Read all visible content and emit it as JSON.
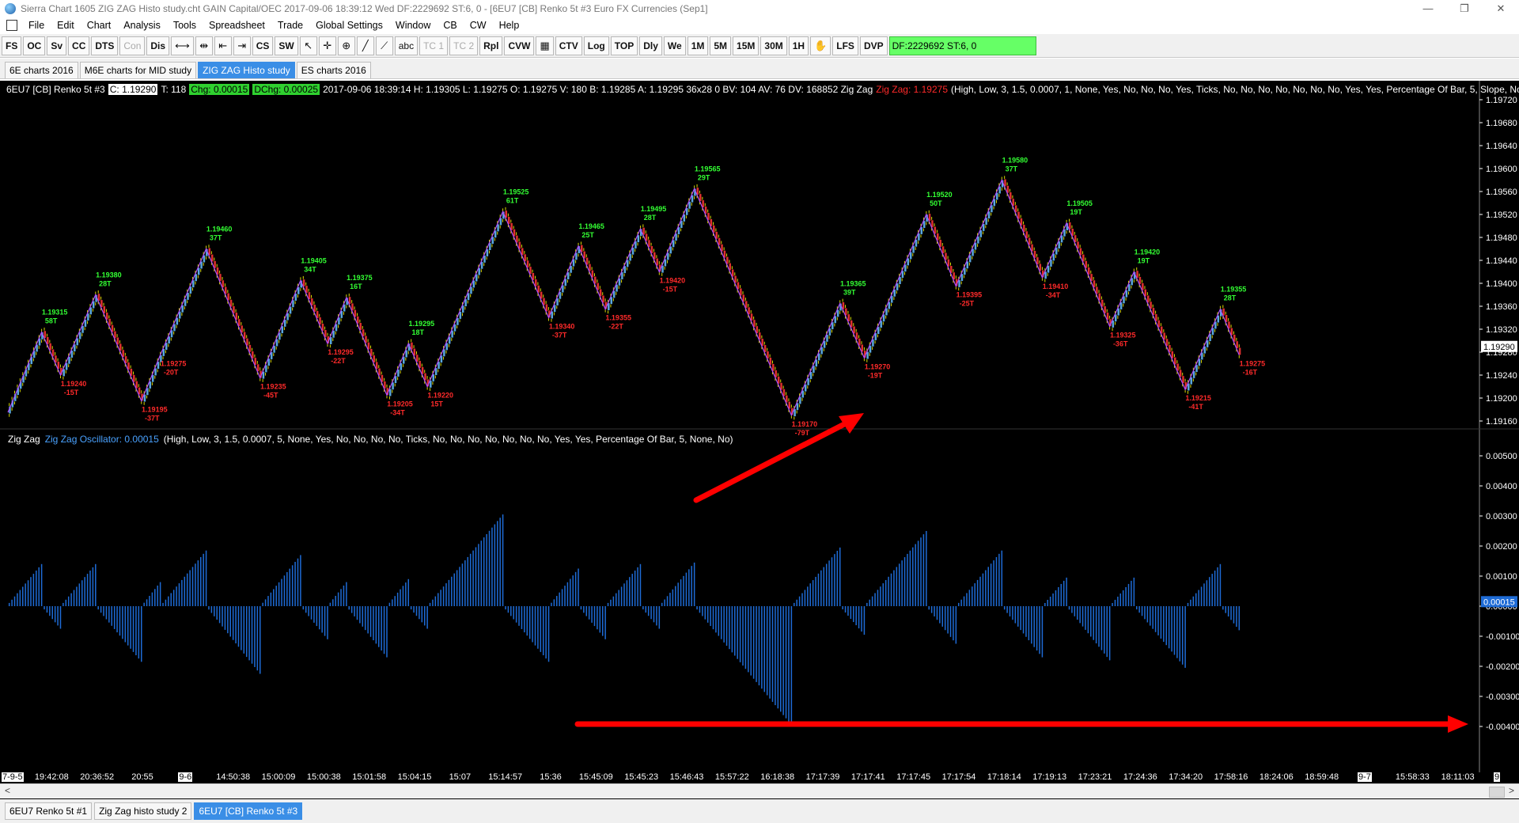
{
  "window": {
    "title": "Sierra Chart 1605 ZIG ZAG Histo study.cht  GAIN Capital/OEC 2017-09-06  18:39:12 Wed  DF:2229692  ST:6, 0 - [6EU7 [CB]  Renko 5t  #3  Euro FX Currencies (Sep1]",
    "controls": [
      "—",
      "❐",
      "✕"
    ]
  },
  "menu": [
    "File",
    "Edit",
    "Chart",
    "Analysis",
    "Tools",
    "Spreadsheet",
    "Trade",
    "Global Settings",
    "Window",
    "CB",
    "CW",
    "Help"
  ],
  "toolbar": {
    "group1": [
      "FS",
      "OC",
      "Sv",
      "CC",
      "DTS",
      "Con",
      "Dis"
    ],
    "group2": [
      "CS",
      "SW"
    ],
    "group3": [
      "abc",
      "TC 1",
      "TC 2",
      "Rpl",
      "CVW"
    ],
    "group4": [
      "CTV",
      "Log",
      "TOP",
      "Dly",
      "We",
      "1M",
      "5M",
      "15M",
      "30M",
      "1H"
    ],
    "group5": [
      "LFS",
      "DVP"
    ],
    "status": "DF:2229692  ST:6, 0"
  },
  "chart_tabs": [
    "6E charts 2016",
    "M6E charts for MID study",
    "ZIG ZAG Histo study",
    "ES charts 2016"
  ],
  "active_chart_tab": 2,
  "header": {
    "symbol": "6EU7 [CB]  Renko 5t  #3",
    "close": "C: 1.19290",
    "ticks": "T: 118",
    "chg": "Chg: 0.00015",
    "dchg": "DChg: 0.00025",
    "details": "2017-09-06 18:39:14 H: 1.19305 L: 1.19275 O: 1.19275 V: 180 B: 1.19285 A: 1.19295 36x28 0 BV: 104 AV: 76 DV: 168852 Zig Zag",
    "study_name": "Zig Zag: 1.19275",
    "study_params": "(High, Low, 3, 1.5, 0.0007, 1, None, Yes, No, No, No, Yes, Ticks, No, No, No, No, No, No, No, Yes, Yes, Percentage Of Bar, 5, Slope, No)"
  },
  "lower_header": {
    "name": "Zig Zag",
    "osc": "Zig Zag Oscillator: 0.00015",
    "params": "(High, Low, 3, 1.5, 0.0007, 5, None, Yes, No, No, No, No, Ticks, No, No, No, No, No, No, No, Yes, Yes, Percentage Of Bar, 5, None, No)"
  },
  "price_axis": [
    "1.19720",
    "1.19680",
    "1.19640",
    "1.19600",
    "1.19560",
    "1.19520",
    "1.19480",
    "1.19440",
    "1.19400",
    "1.19360",
    "1.19320",
    "1.19280",
    "1.19240",
    "1.19200",
    "1.19160"
  ],
  "price_current": "1.19290",
  "osc_axis": [
    "0.00500",
    "0.00400",
    "0.00300",
    "0.00200",
    "0.00100",
    "0.00000",
    "-0.00100",
    "-0.00200",
    "-0.00300",
    "-0.00400"
  ],
  "osc_current": "0.00015",
  "time_axis": [
    "7-9-5",
    "19:42:08",
    "20:36:52",
    "20:55",
    "9-6",
    "14:50:38",
    "15:00:09",
    "15:00:38",
    "15:01:58",
    "15:04:15",
    "15:07",
    "15:14:57",
    "15:36",
    "15:45:09",
    "15:45:23",
    "15:46:43",
    "15:57:22",
    "16:18:38",
    "17:17:39",
    "17:17:41",
    "17:17:45",
    "17:17:54",
    "17:18:14",
    "17:19:13",
    "17:23:21",
    "17:24:36",
    "17:34:20",
    "17:58:16",
    "18:24:06",
    "18:59:48",
    "9-7",
    "15:58:33",
    "18:11:03",
    "9"
  ],
  "zigzag_labels": [
    {
      "price": "1.19315",
      "ticks": "58T",
      "high": true
    },
    {
      "price": "1.19240",
      "ticks": "-15T",
      "high": false
    },
    {
      "price": "1.19380",
      "ticks": "28T",
      "high": true
    },
    {
      "price": "1.19195",
      "ticks": "-37T",
      "high": false
    },
    {
      "price": "1.19275",
      "ticks": "-20T",
      "high": false
    },
    {
      "price": "1.19460",
      "ticks": "37T",
      "high": true
    },
    {
      "price": "1.19235",
      "ticks": "-45T",
      "high": false
    },
    {
      "price": "1.19405",
      "ticks": "34T",
      "high": true
    },
    {
      "price": "1.19295",
      "ticks": "-22T",
      "high": false
    },
    {
      "price": "1.19375",
      "ticks": "16T",
      "high": true
    },
    {
      "price": "1.19205",
      "ticks": "-34T",
      "high": false
    },
    {
      "price": "1.19295",
      "ticks": "18T",
      "high": true
    },
    {
      "price": "1.19220",
      "ticks": "15T",
      "high": false
    },
    {
      "price": "1.19525",
      "ticks": "61T",
      "high": true
    },
    {
      "price": "1.19340",
      "ticks": "-37T",
      "high": false
    },
    {
      "price": "1.19465",
      "ticks": "25T",
      "high": true
    },
    {
      "price": "1.19355",
      "ticks": "-22T",
      "high": false
    },
    {
      "price": "1.19495",
      "ticks": "28T",
      "high": true
    },
    {
      "price": "1.19420",
      "ticks": "-15T",
      "high": false
    },
    {
      "price": "1.19565",
      "ticks": "29T",
      "high": true
    },
    {
      "price": "1.19170",
      "ticks": "-79T",
      "high": false
    },
    {
      "price": "1.19365",
      "ticks": "39T",
      "high": true
    },
    {
      "price": "1.19270",
      "ticks": "-19T",
      "high": false
    },
    {
      "price": "1.19520",
      "ticks": "50T",
      "high": true
    },
    {
      "price": "1.19395",
      "ticks": "-25T",
      "high": false
    },
    {
      "price": "1.19580",
      "ticks": "37T",
      "high": true
    },
    {
      "price": "1.19410",
      "ticks": "-34T",
      "high": false
    },
    {
      "price": "1.19505",
      "ticks": "19T",
      "high": true
    },
    {
      "price": "1.19325",
      "ticks": "-36T",
      "high": false
    },
    {
      "price": "1.19420",
      "ticks": "19T",
      "high": true
    },
    {
      "price": "1.19215",
      "ticks": "-41T",
      "high": false
    },
    {
      "price": "1.19355",
      "ticks": "28T",
      "high": true
    },
    {
      "price": "1.19275",
      "ticks": "-16T",
      "high": false
    }
  ],
  "bottom_tabs": [
    "6EU7  Renko 5t  #1",
    "Zig Zag histo study 2",
    "6EU7 [CB]  Renko 5t  #3"
  ],
  "active_bottom_tab": 2,
  "colors": {
    "up_candle": "#5aa7e0",
    "down_candle": "#e03030",
    "zigzag_line": "#b04dff",
    "high_label": "#33ff33",
    "low_label": "#ff2a2a",
    "histogram": "#1e6bd6",
    "annotation_arrow": "#ff0000"
  }
}
